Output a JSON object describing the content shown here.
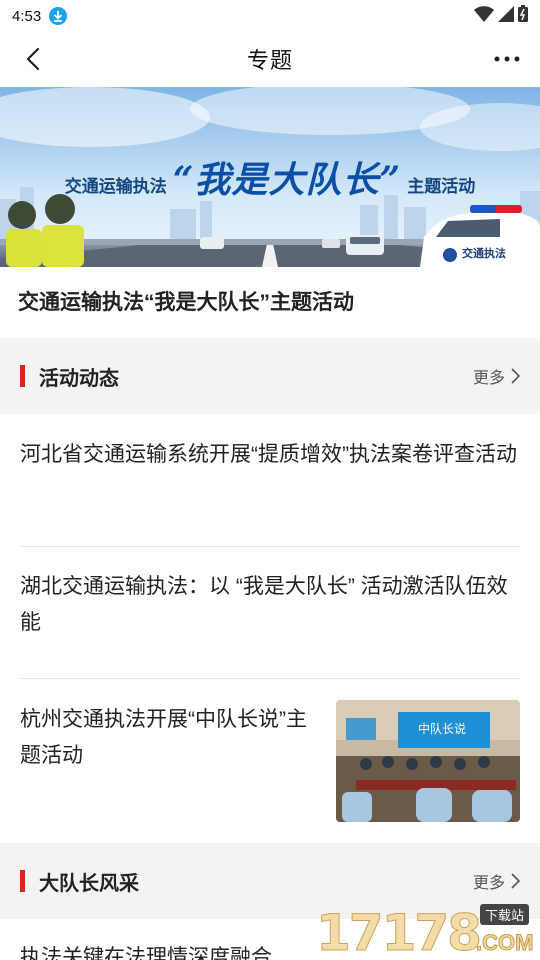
{
  "status_bar": {
    "time": "4:53"
  },
  "nav": {
    "title": "专题"
  },
  "banner": {
    "subtitle_left": "交通运输执法",
    "main_title": "“我是大队长”",
    "subtitle_right": "主题活动",
    "car_label": "交通执法"
  },
  "topic": {
    "title": "交通运输执法“我是大队长”主题活动"
  },
  "sections": [
    {
      "title": "活动动态",
      "more": "更多",
      "articles": [
        {
          "title": "河北省交通运输系统开展“提质增效”执法案卷评查活动"
        },
        {
          "title": "湖北交通运输执法：以 “我是大队长” 活动激活队伍效能"
        },
        {
          "title": "杭州交通执法开展“中队长说”主题活动",
          "thumb_caption": "中队长说"
        }
      ]
    },
    {
      "title": "大队长风采",
      "more": "更多",
      "articles": [
        {
          "title": "执法关键在法理情深度融合"
        }
      ]
    }
  ],
  "watermark": {
    "text": "17178",
    "badge": "下载站",
    "suffix": ".COM"
  },
  "colors": {
    "accent_red": "#d7261e",
    "download_blue": "#1aa1f0",
    "banner_blue": "#0b4fa6"
  }
}
